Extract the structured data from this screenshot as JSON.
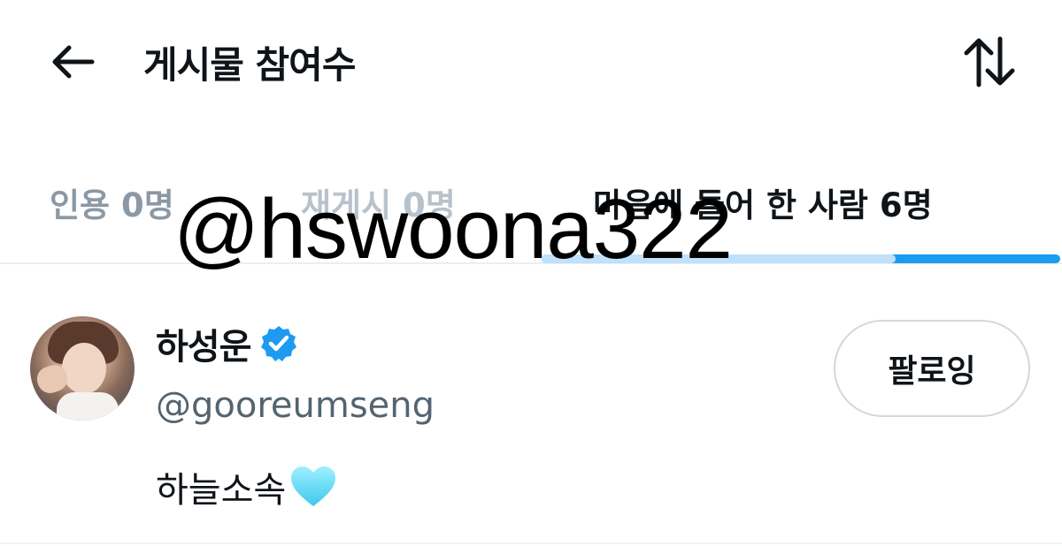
{
  "header": {
    "title": "게시물 참여수",
    "back_icon": "arrow-left-icon",
    "sort_icon": "sort-arrows-icon"
  },
  "tabs": [
    {
      "label": "인용 0명",
      "active": false
    },
    {
      "label": "재게시 0명",
      "active": false
    },
    {
      "label": "마음에 들어 한 사람 6명",
      "active": true
    }
  ],
  "watermark": "@hswoona322",
  "user": {
    "display_name": "하성운",
    "handle": "@gooreumseng",
    "bio": "하늘소속",
    "bio_emoji": "light-blue-heart-icon",
    "verified": true,
    "follow_label": "팔로잉"
  },
  "colors": {
    "accent": "#1d9bf0",
    "text": "#0f1419",
    "secondary": "#536471",
    "tab_inactive": "#8b98a5",
    "border": "#cfd9de"
  }
}
